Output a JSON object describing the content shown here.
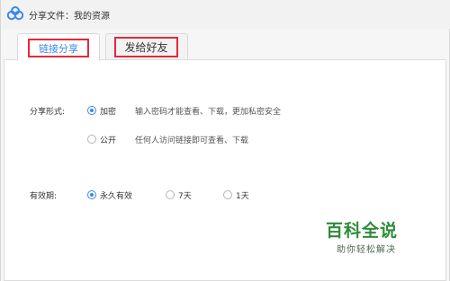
{
  "window": {
    "title": "分享文件：我的资源",
    "app_icon": "baidu-netdisk-logo-icon"
  },
  "tabs": [
    {
      "label": "链接分享",
      "active": true
    },
    {
      "label": "发给好友",
      "active": false
    }
  ],
  "share_form": {
    "label": "分享形式:",
    "options": [
      {
        "label": "加密",
        "description": "输入密码才能查看、下载，更加私密安全",
        "checked": true
      },
      {
        "label": "公开",
        "description": "任何人访问链接即可查看、下载",
        "checked": false
      }
    ]
  },
  "validity": {
    "label": "有效期:",
    "options": [
      {
        "label": "永久有效",
        "checked": true
      },
      {
        "label": "7天",
        "checked": false
      },
      {
        "label": "1天",
        "checked": false
      }
    ]
  },
  "watermark": {
    "main": "百科全说",
    "sub": "助你轻松解决"
  },
  "colors": {
    "accent": "#3a88ee",
    "highlight_box": "#e6283a",
    "watermark": "#2e8b3a"
  }
}
